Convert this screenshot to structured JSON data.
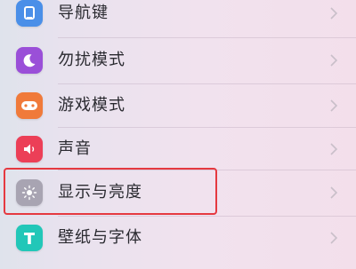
{
  "settings": {
    "items": [
      {
        "label": "导航键",
        "icon": "navigation-key-icon",
        "color": "#4a8fe8"
      },
      {
        "label": "勿扰模式",
        "icon": "moon-icon",
        "color": "#9a4fd8"
      },
      {
        "label": "游戏模式",
        "icon": "gamepad-icon",
        "color": "#f07a3a"
      },
      {
        "label": "声音",
        "icon": "speaker-icon",
        "color": "#ec3f57"
      },
      {
        "label": "显示与亮度",
        "icon": "sun-icon",
        "color": "#a8a4b2"
      },
      {
        "label": "壁纸与字体",
        "icon": "text-t-icon",
        "color": "#22c7b8"
      }
    ]
  },
  "highlight_color": "#e53940"
}
